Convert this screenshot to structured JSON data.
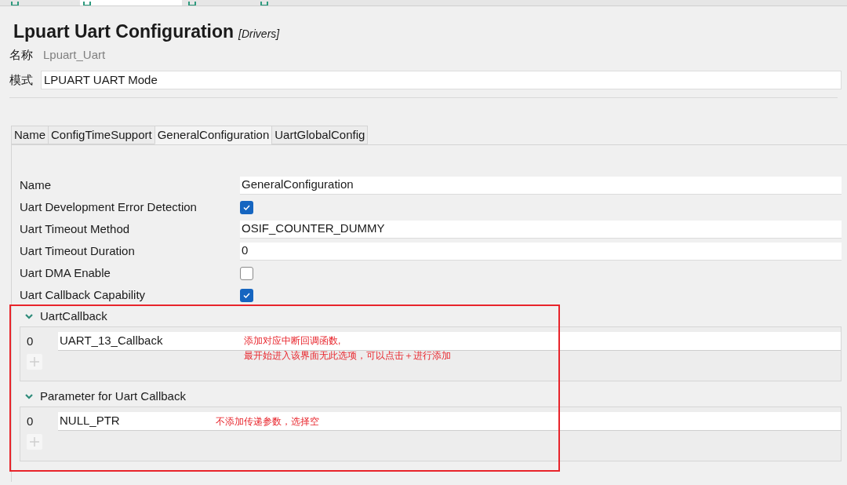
{
  "editor_tabs": [
    {
      "selected": false
    },
    {
      "selected": true
    },
    {
      "selected": false
    },
    {
      "selected": false
    }
  ],
  "title": "Lpuart Uart Configuration",
  "title_tag": "[Drivers]",
  "header_fields": [
    {
      "label": "名称",
      "value": "Lpuart_Uart",
      "disabled": true
    },
    {
      "label": "模式",
      "value": "LPUART UART Mode",
      "disabled": false
    }
  ],
  "tabs": [
    {
      "label": "Name",
      "selected": false
    },
    {
      "label": "ConfigTimeSupport",
      "selected": false
    },
    {
      "label": "GeneralConfiguration",
      "selected": true
    },
    {
      "label": "UartGlobalConfig",
      "selected": false
    }
  ],
  "rows": [
    {
      "kind": "text",
      "label": "Name",
      "value": "GeneralConfiguration"
    },
    {
      "kind": "checkbox",
      "label": "Uart Development Error Detection",
      "checked": true
    },
    {
      "kind": "text",
      "label": "Uart Timeout Method",
      "value": "OSIF_COUNTER_DUMMY"
    },
    {
      "kind": "text",
      "label": "Uart Timeout Duration",
      "value": "0"
    },
    {
      "kind": "checkbox",
      "label": "Uart DMA Enable",
      "checked": false
    },
    {
      "kind": "checkbox",
      "label": "Uart Callback Capability",
      "checked": true
    }
  ],
  "sections": [
    {
      "title": "UartCallback",
      "expanded": true,
      "items": [
        {
          "index": "0",
          "value": "UART_13_Callback"
        }
      ],
      "note": [
        "添加对应中断回调函数,",
        "最开始进入该界面无此选项，可以点击＋进行添加"
      ]
    },
    {
      "title": "Parameter for Uart Callback",
      "expanded": true,
      "items": [
        {
          "index": "0",
          "value": "NULL_PTR"
        }
      ],
      "note": [
        "不添加传递参数，选择空"
      ]
    }
  ]
}
